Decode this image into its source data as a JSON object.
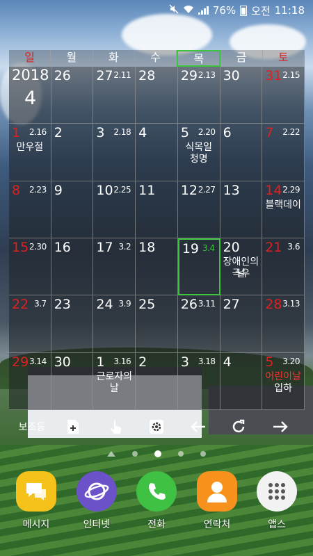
{
  "status_bar": {
    "battery": "76%",
    "ampm": "오전",
    "time": "11:18"
  },
  "calendar": {
    "year": "2018",
    "month": "4",
    "weekdays": [
      "일",
      "월",
      "화",
      "수",
      "목",
      "금",
      "토"
    ],
    "weeks": [
      [
        {
          "d": "",
          "l": ""
        },
        {
          "d": "26",
          "l": ""
        },
        {
          "d": "27",
          "l": "2.11"
        },
        {
          "d": "28",
          "l": ""
        },
        {
          "d": "29",
          "l": "2.13"
        },
        {
          "d": "30",
          "l": ""
        },
        {
          "d": "31",
          "l": "2.15"
        }
      ],
      [
        {
          "d": "1",
          "l": "2.16",
          "h": "만우절"
        },
        {
          "d": "2",
          "l": ""
        },
        {
          "d": "3",
          "l": "2.18"
        },
        {
          "d": "4",
          "l": ""
        },
        {
          "d": "5",
          "l": "2.20",
          "h": "식목일",
          "h2": "청명"
        },
        {
          "d": "6",
          "l": ""
        },
        {
          "d": "7",
          "l": "2.22"
        }
      ],
      [
        {
          "d": "8",
          "l": "2.23"
        },
        {
          "d": "9",
          "l": ""
        },
        {
          "d": "10",
          "l": "2.25"
        },
        {
          "d": "11",
          "l": ""
        },
        {
          "d": "12",
          "l": "2.27"
        },
        {
          "d": "13",
          "l": ""
        },
        {
          "d": "14",
          "l": "2.29",
          "h": "블랙데이"
        }
      ],
      [
        {
          "d": "15",
          "l": "2.30"
        },
        {
          "d": "16",
          "l": ""
        },
        {
          "d": "17",
          "l": "3.2"
        },
        {
          "d": "18",
          "l": ""
        },
        {
          "d": "19",
          "l": "3.4"
        },
        {
          "d": "20",
          "l": "",
          "h": "장애인의날",
          "h2": "곡우"
        },
        {
          "d": "21",
          "l": "3.6"
        }
      ],
      [
        {
          "d": "22",
          "l": "3.7"
        },
        {
          "d": "23",
          "l": ""
        },
        {
          "d": "24",
          "l": "3.9"
        },
        {
          "d": "25",
          "l": ""
        },
        {
          "d": "26",
          "l": "3.11"
        },
        {
          "d": "27",
          "l": ""
        },
        {
          "d": "28",
          "l": "3.13"
        }
      ],
      [
        {
          "d": "29",
          "l": "3.14"
        },
        {
          "d": "30",
          "l": ""
        },
        {
          "d": "1",
          "l": "3.16",
          "h": "근로자의날"
        },
        {
          "d": "2",
          "l": ""
        },
        {
          "d": "3",
          "l": "3.18"
        },
        {
          "d": "4",
          "l": ""
        },
        {
          "d": "5",
          "l": "3.20",
          "h": "어린이날",
          "h_red": true,
          "h2": "입하"
        }
      ]
    ]
  },
  "toolbar": {
    "sub_label": "보조등"
  },
  "dock": [
    {
      "label": "메시지",
      "color": "#f5c21b"
    },
    {
      "label": "인터넷",
      "color": "#6b52c9"
    },
    {
      "label": "전화",
      "color": "#3fc144"
    },
    {
      "label": "연락처",
      "color": "#f7921e"
    },
    {
      "label": "앱스",
      "color": "#f2f2f2"
    }
  ]
}
